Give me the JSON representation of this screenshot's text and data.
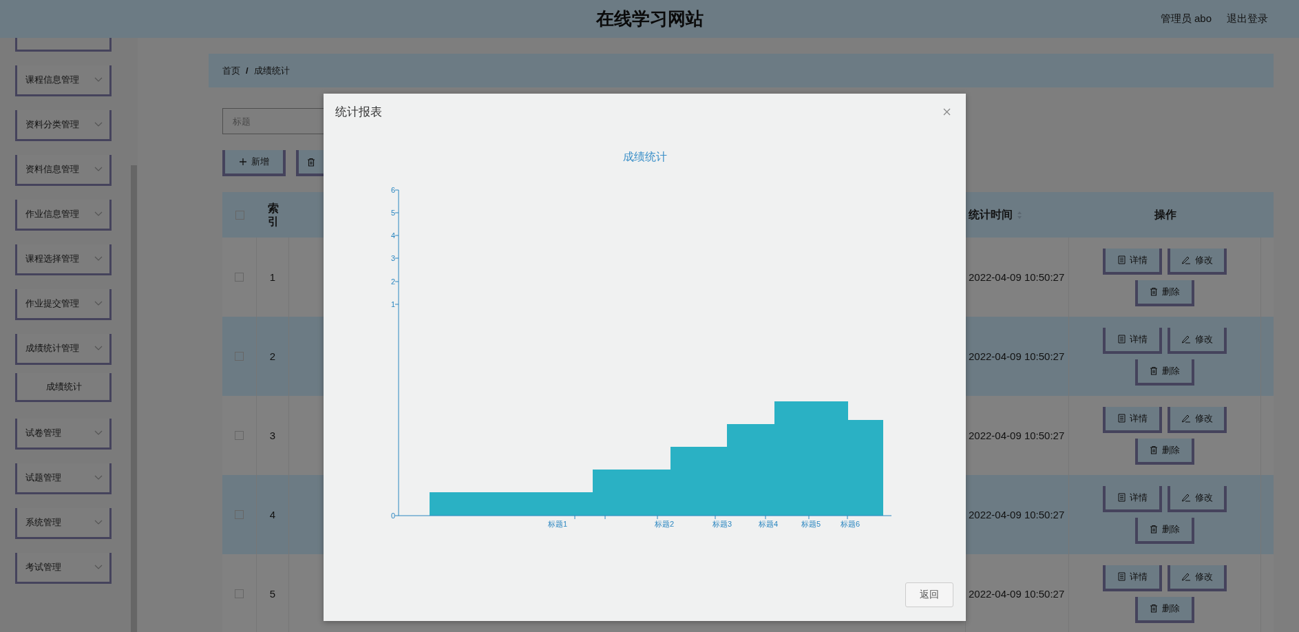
{
  "header": {
    "title": "在线学习网站",
    "user": "管理员 abo",
    "logout": "退出登录"
  },
  "sidebar": {
    "items": [
      {
        "label": "课程信息管理"
      },
      {
        "label": "资料分类管理"
      },
      {
        "label": "资料信息管理"
      },
      {
        "label": "作业信息管理"
      },
      {
        "label": "课程选择管理"
      },
      {
        "label": "作业提交管理"
      },
      {
        "label": "成绩统计管理",
        "children": [
          {
            "label": "成绩统计"
          }
        ]
      },
      {
        "label": "试卷管理"
      },
      {
        "label": "试题管理"
      },
      {
        "label": "系统管理"
      },
      {
        "label": "考试管理"
      }
    ]
  },
  "breadcrumb": {
    "items": [
      "首页",
      "成绩统计"
    ],
    "separator": "/"
  },
  "search": {
    "placeholder": "标题"
  },
  "toolbar": [
    {
      "kind": "add",
      "label": "新增"
    },
    {
      "kind": "delete"
    }
  ],
  "table": {
    "all_checked": false,
    "columns": [
      {
        "kind": "check"
      },
      {
        "kind": "index",
        "label": "索引"
      },
      {
        "kind": "hidden"
      },
      {
        "kind": "sort",
        "label": "统计时间"
      },
      {
        "kind": "text",
        "label": "操作"
      }
    ],
    "rows": [
      {
        "index": "1",
        "time": "2022-04-09 10:50:27",
        "checked": false,
        "actions": [
          {
            "kind": "detail",
            "label": "详情"
          },
          {
            "kind": "edit",
            "label": "修改"
          },
          {
            "kind": "delete",
            "label": "删除"
          }
        ]
      },
      {
        "index": "2",
        "time": "2022-04-09 10:50:27",
        "checked": false,
        "actions": [
          {
            "kind": "detail",
            "label": "详情"
          },
          {
            "kind": "edit",
            "label": "修改"
          },
          {
            "kind": "delete",
            "label": "删除"
          }
        ]
      },
      {
        "index": "3",
        "time": "2022-04-09 10:50:27",
        "checked": false,
        "actions": [
          {
            "kind": "detail",
            "label": "详情"
          },
          {
            "kind": "edit",
            "label": "修改"
          },
          {
            "kind": "delete",
            "label": "删除"
          }
        ]
      },
      {
        "index": "4",
        "time": "2022-04-09 10:50:27",
        "checked": false,
        "actions": [
          {
            "kind": "detail",
            "label": "详情"
          },
          {
            "kind": "edit",
            "label": "修改"
          },
          {
            "kind": "delete",
            "label": "删除"
          }
        ]
      },
      {
        "index": "5",
        "time": "2022-04-09 10:50:27",
        "checked": false,
        "actions": [
          {
            "kind": "detail",
            "label": "详情"
          },
          {
            "kind": "edit",
            "label": "修改"
          },
          {
            "kind": "delete",
            "label": "删除"
          }
        ]
      }
    ]
  },
  "modal": {
    "title": "统计报表",
    "chart": {
      "title": "成绩统计",
      "y_ticks": [
        "6",
        "5",
        "4",
        "3",
        "2",
        "1",
        "0"
      ],
      "x_labels": [
        "标题1",
        "标题2",
        "标题3",
        "标题4",
        "标题5",
        "标题6"
      ]
    },
    "button": "返回"
  }
}
